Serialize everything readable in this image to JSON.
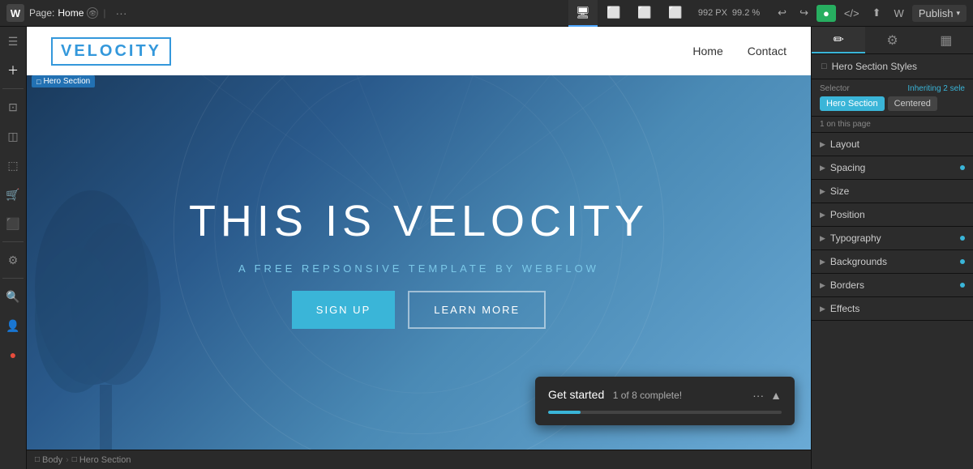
{
  "topbar": {
    "logo": "W",
    "page_label": "Page:",
    "page_name": "Home",
    "dots": "···",
    "dims_px": "992 PX",
    "dims_pct": "99.2 %",
    "undo": "↩",
    "redo": "↪",
    "code_btn": "</>",
    "export_btn": "⬆",
    "wf_btn": "W",
    "publish_label": "Publish",
    "icons": {
      "desktop": "🖥",
      "tablet": "📱",
      "mobile_l": "📱",
      "mobile_s": "📱"
    }
  },
  "left_sidebar": {
    "icons": [
      "☰",
      "＋",
      "—",
      "⋮",
      "⊡",
      "🛒",
      "⬚",
      "⚙",
      "🔍",
      "👤"
    ]
  },
  "canvas": {
    "site_logo": "VELOCITY",
    "nav_links": [
      "Home",
      "Contact"
    ],
    "hero_label": "Hero Section",
    "hero_title": "THIS IS VELOCITY",
    "hero_subtitle": "A FREE REPSONSIVE TEMPLATE BY WEBFLOW",
    "hero_btn_primary": "SIGN UP",
    "hero_btn_secondary": "LEARN MORE"
  },
  "toast": {
    "title": "Get started",
    "count": "1 of 8 complete!",
    "progress_pct": 14,
    "dots": "···",
    "collapse": "▲"
  },
  "bottom_bar": {
    "body_label": "Body",
    "hero_label": "Hero Section",
    "sep": "›"
  },
  "right_panel": {
    "header_icon": "□",
    "header_title": "Hero Section Styles",
    "selector_label": "Selector",
    "inheriting_label": "Inheriting 2 sele",
    "tags": [
      "Hero Section",
      "Centered"
    ],
    "on_page": "1 on this page",
    "sections": [
      {
        "title": "Layout",
        "has_dot": false
      },
      {
        "title": "Spacing",
        "has_dot": true
      },
      {
        "title": "Size",
        "has_dot": false
      },
      {
        "title": "Position",
        "has_dot": false
      },
      {
        "title": "Typography",
        "has_dot": true
      },
      {
        "title": "Backgrounds",
        "has_dot": true
      },
      {
        "title": "Borders",
        "has_dot": true
      },
      {
        "title": "Effects",
        "has_dot": false
      }
    ],
    "tabs": [
      "✏",
      "⚙",
      "▦"
    ]
  },
  "colors": {
    "accent": "#3ab5d8",
    "panel_bg": "#2c2c2c",
    "topbar_bg": "#2a2a2a",
    "dot_color": "#3ab5d8"
  }
}
